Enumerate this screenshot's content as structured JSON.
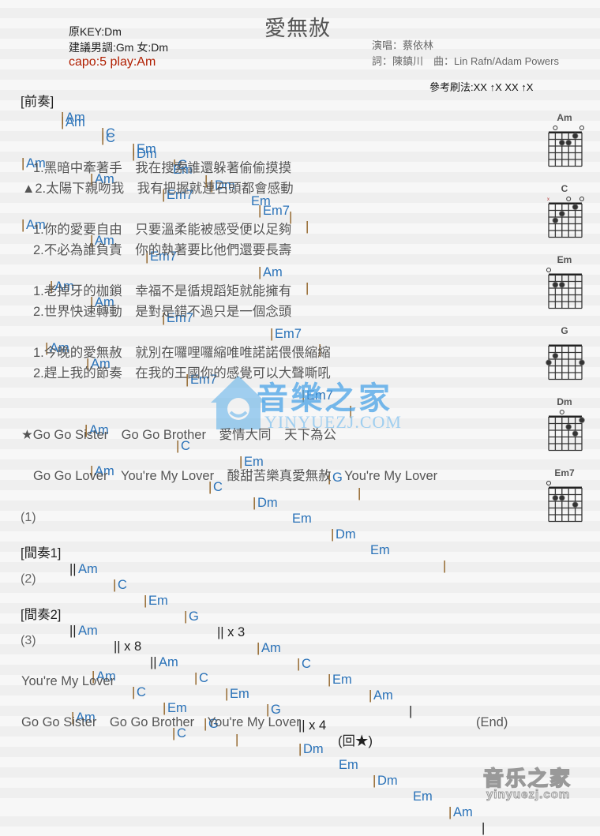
{
  "header": {
    "title": "愛無赦",
    "original_key": "原KEY:Dm",
    "suggested_key": "建議男調:Gm 女:Dm",
    "capo": "capo:5 play:Am",
    "singer": "演唱：蔡依林",
    "credits": "詞：陳鎮川　曲：Lin Rafn/Adam Powers",
    "strum": "參考刷法:XX ↑X XX ↑X"
  },
  "intro": {
    "label": "[前奏]",
    "line1": [
      "Am",
      "C",
      "Em",
      "G"
    ],
    "line2": [
      "Am",
      "C",
      "Dm",
      "Em",
      "Dm",
      "Em"
    ]
  },
  "verse": {
    "chords1": [
      "Am",
      "Am",
      "Em7",
      "Em7"
    ],
    "lyrics1a": "1.黑暗中牽著手　我在搜索誰還躲著偷偷摸摸",
    "lyrics1b": "▲2.太陽下親吻我　我有把握就連石頭都會感動",
    "chords2": [
      "Am",
      "Am",
      "Em7",
      "Am"
    ],
    "lyrics2a": "1.你的愛要自由　只要溫柔能被感受便以足夠",
    "lyrics2b": "2.不必為誰負責　你的執著要比他們還要長壽",
    "chords3": [
      "Am",
      "Am",
      "Em7",
      "Em7"
    ],
    "lyrics3a": "1.老掉牙的枷鎖　幸福不是循規蹈矩就能擁有",
    "lyrics3b": "2.世界快速轉動　是對是錯不過只是一個念頭",
    "chords4": [
      "Am",
      "Am",
      "Em7",
      "Em7"
    ],
    "lyrics4a": "1.今晚的愛無赦　就別在囉哩囉縮唯唯諾諾偎偎縮縮",
    "lyrics4b": "2.趕上我的節奏　在我的王國你的感覺可以大聲嘶吼"
  },
  "chorus": {
    "chords1": [
      "Am",
      "C",
      "Em",
      "G"
    ],
    "lyrics1": "★Go Go Sister　Go Go Brother　愛情大同　天下為公",
    "chords2": [
      "Am",
      "C",
      "Dm",
      "Em",
      "Dm",
      "Em"
    ],
    "lyrics2": "Go Go Lover　You're My Lover　酸甜苦樂真愛無赦　You're My Lover"
  },
  "section1": {
    "num": "(1)",
    "label": "[間奏1]",
    "chords_a": [
      "Am",
      "C",
      "Em",
      "G"
    ],
    "repeat": "|| x 3",
    "chords_b": [
      "Am",
      "C",
      "Em",
      "Am"
    ]
  },
  "section2": {
    "num": "(2)",
    "label": "[間奏2]",
    "chord_a": "Am",
    "repeat_a": "|| x 8",
    "chords_b": [
      "Am",
      "C",
      "Em",
      "G"
    ],
    "repeat_b": "|| x 4",
    "back": "(回★)"
  },
  "section3": {
    "num": "(3)",
    "chords1": [
      "Am",
      "C",
      "Em",
      "G"
    ],
    "lyrics1": "You're My Lover",
    "chords2": [
      "Am",
      "C",
      "Dm",
      "Em",
      "Dm",
      "Em",
      "Am"
    ],
    "lyrics2": "Go Go Sister　Go Go Brother　You're My Lover",
    "end": "(End)"
  },
  "chord_diagrams": [
    {
      "name": "Am"
    },
    {
      "name": "C"
    },
    {
      "name": "Em"
    },
    {
      "name": "G"
    },
    {
      "name": "Dm"
    },
    {
      "name": "Em7"
    }
  ],
  "watermark": {
    "text": "音樂之家",
    "sub": "YINYUEZJ.COM",
    "bottom": "音乐之家",
    "bottom_sub": "yinyuezj.com"
  }
}
